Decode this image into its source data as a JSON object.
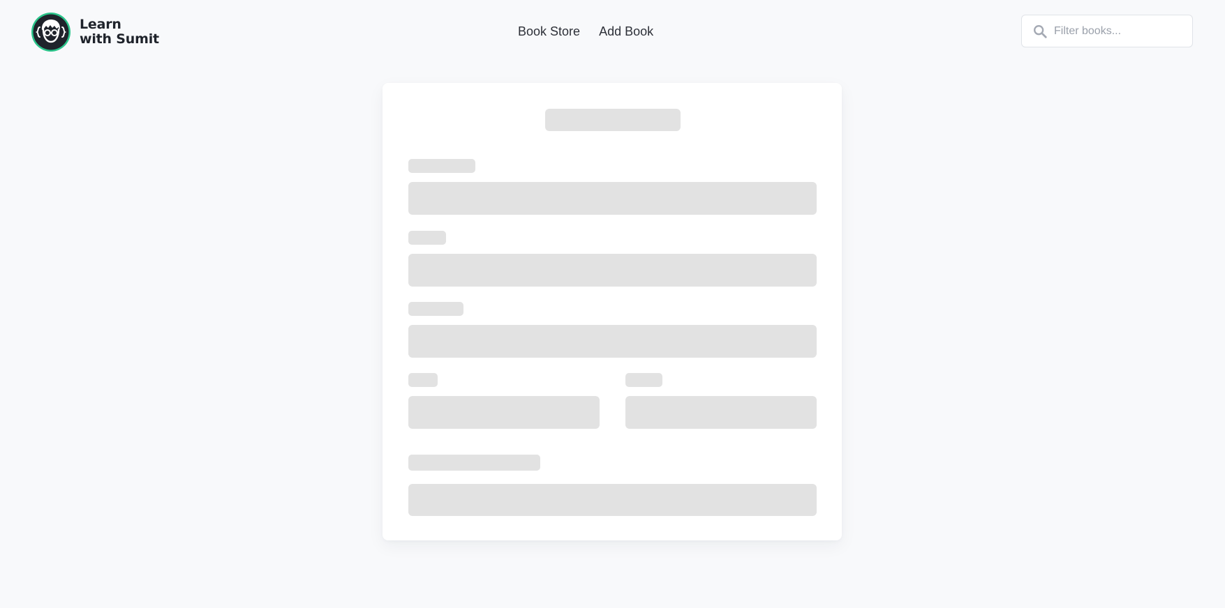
{
  "brand": {
    "name_line1": "Learn",
    "name_line2": "with Sumit",
    "logo_icon": "developer-avatar-icon",
    "logo_ring_color": "#2bc48a",
    "logo_bg_color": "#1f232b"
  },
  "nav": {
    "items": [
      {
        "label": "Book Store"
      },
      {
        "label": "Add Book"
      }
    ]
  },
  "search": {
    "placeholder": "Filter books...",
    "value": "",
    "icon": "search-icon"
  },
  "form_skeleton": {
    "state": "loading",
    "skeleton_color": "#e2e2e2"
  }
}
